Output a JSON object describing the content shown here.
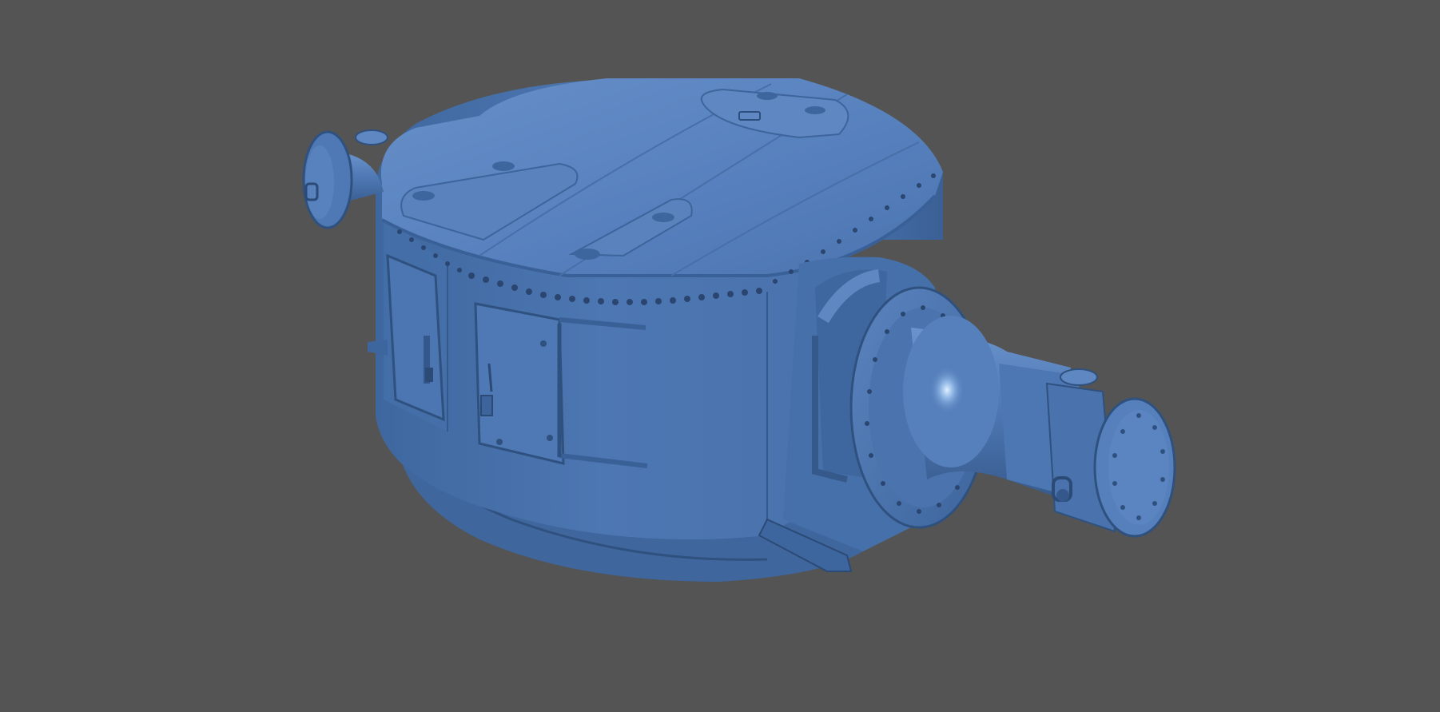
{
  "scene": {
    "subject": "3d-model-render",
    "colors": {
      "background": "#545454",
      "model_base": "#4a74b0",
      "model_light": "#6b93cc",
      "model_dark": "#2f517f",
      "model_shadow": "#253f63",
      "rivet": "#2a4670",
      "specular": "#d8ecff"
    }
  }
}
